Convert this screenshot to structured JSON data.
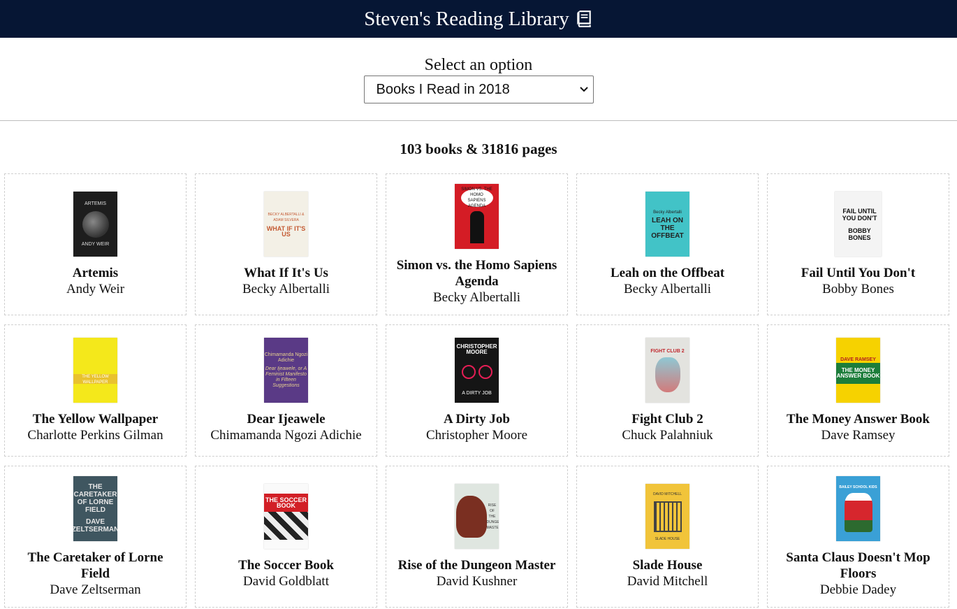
{
  "header": {
    "title": "Steven's Reading Library",
    "icon": "book-icon"
  },
  "controls": {
    "label": "Select an option",
    "selected": "Books I Read in 2018"
  },
  "summary": "103 books & 31816 pages",
  "books": [
    {
      "title": "Artemis",
      "author": "Andy Weir",
      "cover_text": [
        "ARTEMIS",
        "ANDY WEIR"
      ]
    },
    {
      "title": "What If It's Us",
      "author": "Becky Albertalli",
      "cover_text": [
        "BECKY ALBERTALLI & ADAM SILVERA",
        "WHAT IF IT'S US"
      ]
    },
    {
      "title": "Simon vs. the Homo Sapiens Agenda",
      "author": "Becky Albertalli",
      "cover_text": [
        "SIMON VS. THE HOMO SAPIENS AGENDA"
      ]
    },
    {
      "title": "Leah on the Offbeat",
      "author": "Becky Albertalli",
      "cover_text": [
        "Becky Albertalli",
        "LEAH ON THE OFFBEAT"
      ]
    },
    {
      "title": "Fail Until You Don't",
      "author": "Bobby Bones",
      "cover_text": [
        "FAIL UNTIL YOU DON'T",
        "BOBBY BONES"
      ]
    },
    {
      "title": "The Yellow Wallpaper",
      "author": "Charlotte Perkins Gilman",
      "cover_text": [
        "THE YELLOW WALLPAPER"
      ]
    },
    {
      "title": "Dear Ijeawele",
      "author": "Chimamanda Ngozi Adichie",
      "cover_text": [
        "Chimamanda Ngozi Adichie",
        "Dear Ijeawele, or A Feminist Manifesto in Fifteen Suggestions"
      ]
    },
    {
      "title": "A Dirty Job",
      "author": "Christopher Moore",
      "cover_text": [
        "CHRISTOPHER MOORE",
        "A DIRTY JOB"
      ]
    },
    {
      "title": "Fight Club 2",
      "author": "Chuck Palahniuk",
      "cover_text": [
        "FIGHT CLUB 2"
      ]
    },
    {
      "title": "The Money Answer Book",
      "author": "Dave Ramsey",
      "cover_text": [
        "DAVE RAMSEY",
        "THE MONEY ANSWER BOOK"
      ]
    },
    {
      "title": "The Caretaker of Lorne Field",
      "author": "Dave Zeltserman",
      "cover_text": [
        "THE CARETAKER OF LORNE FIELD",
        "DAVE ZELTSERMAN"
      ]
    },
    {
      "title": "The Soccer Book",
      "author": "David Goldblatt",
      "cover_text": [
        "THE SOCCER BOOK"
      ]
    },
    {
      "title": "Rise of the Dungeon Master",
      "author": "David Kushner",
      "cover_text": [
        "RISE OF THE DUNGEON MASTER"
      ]
    },
    {
      "title": "Slade House",
      "author": "David Mitchell",
      "cover_text": [
        "DAVID MITCHELL",
        "SLADE HOUSE"
      ]
    },
    {
      "title": "Santa Claus Doesn't Mop Floors",
      "author": "Debbie Dadey",
      "cover_text": [
        "BAILEY SCHOOL KIDS"
      ]
    }
  ]
}
